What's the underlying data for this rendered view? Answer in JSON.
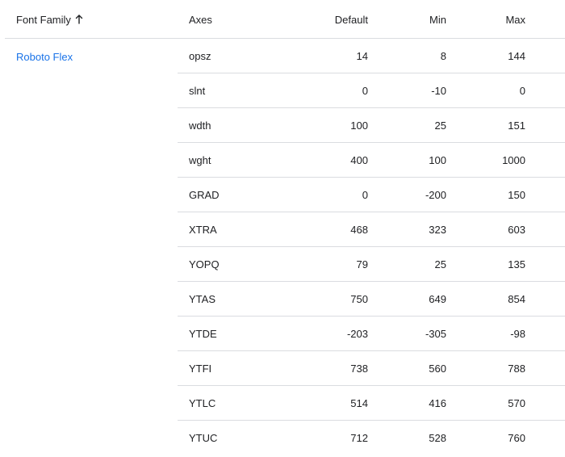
{
  "table": {
    "headers": {
      "font_family": "Font Family",
      "axes": "Axes",
      "default": "Default",
      "min": "Min",
      "max": "Max"
    },
    "sort_icon": "arrow-up-icon",
    "family": "Roboto Flex",
    "link_color": "#1a73e8",
    "rows": [
      {
        "axis": "opsz",
        "default": "14",
        "min": "8",
        "max": "144"
      },
      {
        "axis": "slnt",
        "default": "0",
        "min": "-10",
        "max": "0"
      },
      {
        "axis": "wdth",
        "default": "100",
        "min": "25",
        "max": "151"
      },
      {
        "axis": "wght",
        "default": "400",
        "min": "100",
        "max": "1000"
      },
      {
        "axis": "GRAD",
        "default": "0",
        "min": "-200",
        "max": "150"
      },
      {
        "axis": "XTRA",
        "default": "468",
        "min": "323",
        "max": "603"
      },
      {
        "axis": "YOPQ",
        "default": "79",
        "min": "25",
        "max": "135"
      },
      {
        "axis": "YTAS",
        "default": "750",
        "min": "649",
        "max": "854"
      },
      {
        "axis": "YTDE",
        "default": "-203",
        "min": "-305",
        "max": "-98"
      },
      {
        "axis": "YTFI",
        "default": "738",
        "min": "560",
        "max": "788"
      },
      {
        "axis": "YTLC",
        "default": "514",
        "min": "416",
        "max": "570"
      },
      {
        "axis": "YTUC",
        "default": "712",
        "min": "528",
        "max": "760"
      }
    ]
  }
}
